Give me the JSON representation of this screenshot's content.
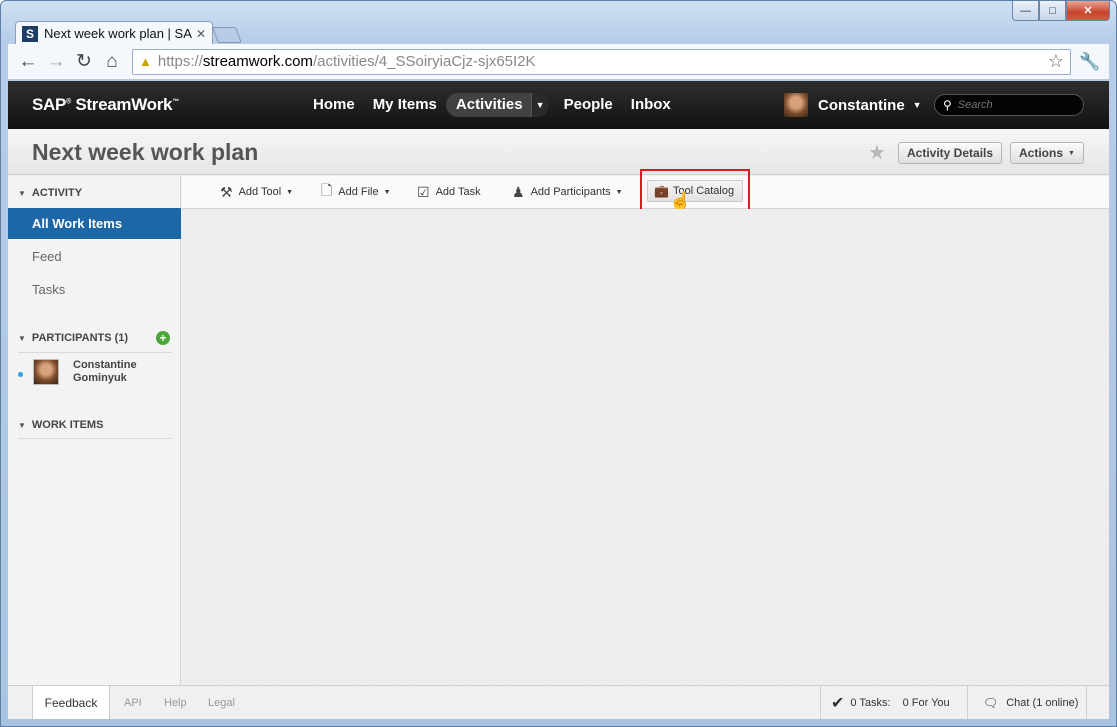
{
  "browser": {
    "tab_title": "Next week work plan | SAP S",
    "tab_favicon": "S",
    "url_proto": "https://",
    "url_host": "streamwork.com",
    "url_path": "/activities/4_SSoiryiaCjz-sjx65I2K"
  },
  "app": {
    "logo": "SAP",
    "logo_rest": "StreamWork",
    "nav": [
      {
        "label": "Home"
      },
      {
        "label": "My Items"
      },
      {
        "label": "Activities"
      },
      {
        "label": "People"
      },
      {
        "label": "Inbox"
      }
    ],
    "user_name": "Constantine",
    "search_placeholder": "Search"
  },
  "page": {
    "title": "Next week work plan",
    "activity_details_label": "Activity Details",
    "actions_label": "Actions"
  },
  "sidebar": {
    "activity_heading": "ACTIVITY",
    "items": [
      {
        "label": "All Work Items",
        "active": true
      },
      {
        "label": "Feed"
      },
      {
        "label": "Tasks"
      }
    ],
    "participants_heading": "PARTICIPANTS (1)",
    "participant_first": "Constantine",
    "participant_last": "Gominyuk",
    "work_items_heading": "WORK ITEMS"
  },
  "toolbar": {
    "add_tool": "Add Tool",
    "add_file": "Add File",
    "add_task": "Add Task",
    "add_participants": "Add Participants",
    "tool_catalog": "Tool Catalog"
  },
  "footer": {
    "feedback": "Feedback",
    "api": "API",
    "help": "Help",
    "legal": "Legal",
    "tasks": "0 Tasks:",
    "for_you": "0 For You",
    "chat": "Chat (1 online)"
  },
  "colors": {
    "accent": "#1d67a6",
    "highlight": "#e0171c"
  }
}
